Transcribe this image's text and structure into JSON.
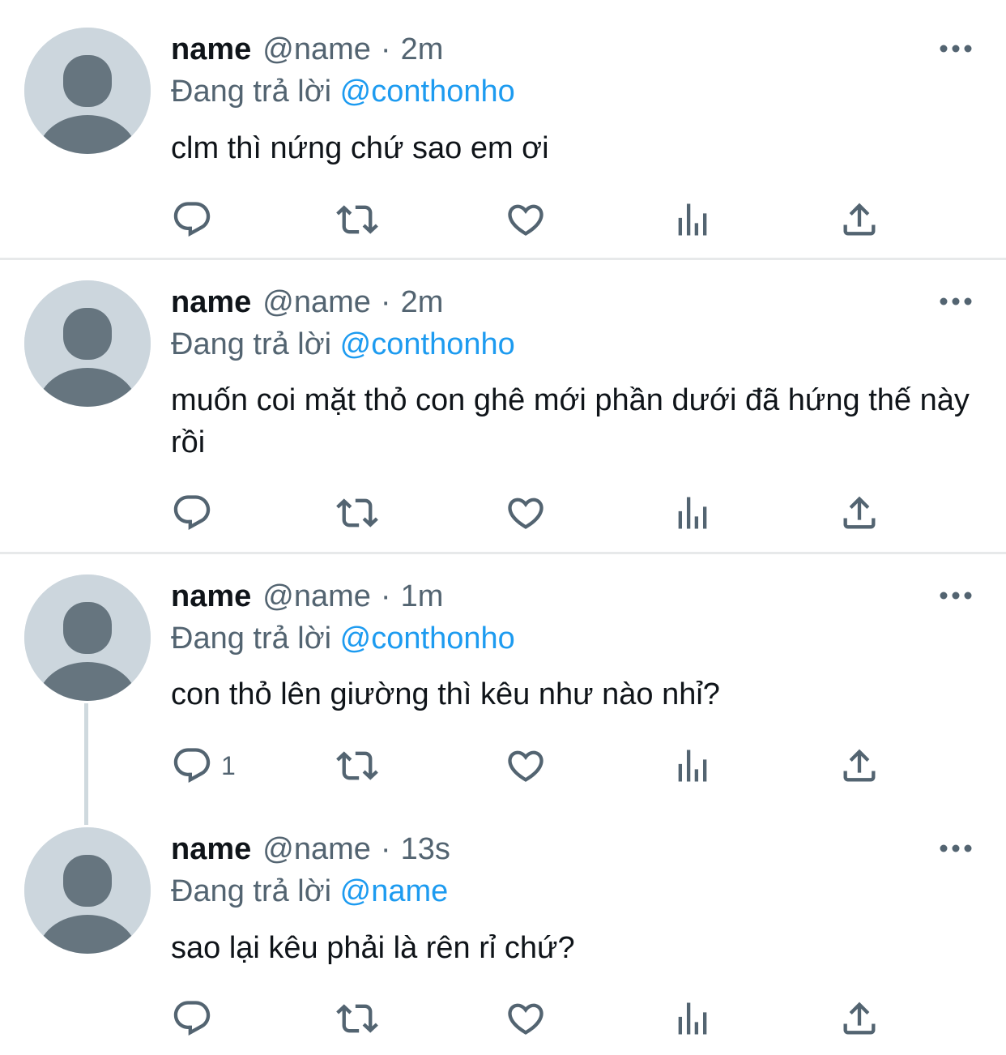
{
  "tweets": [
    {
      "display_name": "name",
      "handle": "@name",
      "separator": "·",
      "time": "2m",
      "reply_prefix": "Đang trả lời",
      "reply_to": "@conthonho",
      "text": "clm thì nứng chứ sao em ơi",
      "reply_count": ""
    },
    {
      "display_name": "name",
      "handle": "@name",
      "separator": "·",
      "time": "2m",
      "reply_prefix": "Đang trả lời",
      "reply_to": "@conthonho",
      "text": "muốn coi mặt thỏ con ghê mới phần dưới đã hứng thế này rồi",
      "reply_count": ""
    },
    {
      "display_name": "name",
      "handle": "@name",
      "separator": "·",
      "time": "1m",
      "reply_prefix": "Đang trả lời",
      "reply_to": "@conthonho",
      "text": "con thỏ lên giường thì kêu như nào nhỉ?",
      "reply_count": "1"
    },
    {
      "display_name": "name",
      "handle": "@name",
      "separator": "·",
      "time": "13s",
      "reply_prefix": "Đang trả lời",
      "reply_to": "@name",
      "text": "sao lại kêu phải là rên rỉ chứ?",
      "reply_count": ""
    }
  ],
  "icons": {
    "reply": "reply-icon",
    "retweet": "retweet-icon",
    "like": "like-icon",
    "views": "views-icon",
    "share": "share-icon",
    "more": "more-icon",
    "avatar": "default-avatar-icon"
  },
  "colors": {
    "text_primary": "#0f1419",
    "text_secondary": "#536471",
    "mention": "#1d9bf0",
    "avatar_bg": "#ccd6dd",
    "avatar_fg": "#66757f",
    "divider": "#e7e9ea",
    "thread_line": "#cfd9de"
  }
}
